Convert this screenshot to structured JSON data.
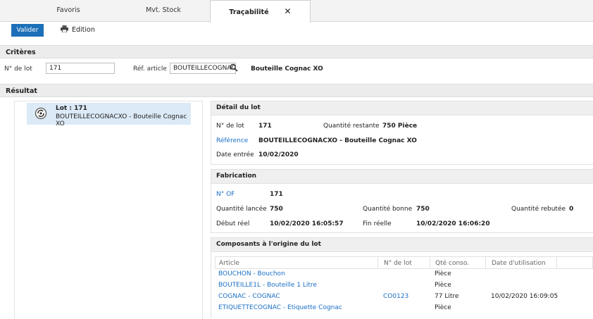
{
  "tabs": [
    {
      "label": "Favoris"
    },
    {
      "label": "Mvt. Stock"
    },
    {
      "label": "Traçabilité",
      "close": "✕"
    }
  ],
  "toolbar": {
    "valider": "Valider",
    "edition": "Edition"
  },
  "criteres": {
    "title": "Critères",
    "lot_label": "N° de lot",
    "lot_value": "171",
    "ref_label": "Réf. article",
    "ref_value": "BOUTEILLECOGNACXO",
    "ref_desc": "Bouteille Cognac XO"
  },
  "resultat": {
    "title": "Résultat",
    "lot_title": "Lot : 171",
    "lot_sub": "BOUTEILLECOGNACXO - Bouteille Cognac XO"
  },
  "detail": {
    "title": "Détail du lot",
    "lot_label": "N° de lot",
    "lot_value": "171",
    "qte_rest_label": "Quantité restante",
    "qte_rest_value": "750 Pièce",
    "ref_label": "Référence",
    "ref_value": "BOUTEILLECOGNACXO - Bouteille Cognac XO",
    "date_label": "Date entrée",
    "date_value": "10/02/2020"
  },
  "fabrication": {
    "title": "Fabrication",
    "of_label": "N° OF",
    "of_value": "171",
    "qte_lancee_label": "Quantité lancée",
    "qte_lancee_value": "750",
    "qte_bonne_label": "Quantité bonne",
    "qte_bonne_value": "750",
    "qte_rebutee_label": "Quantité rebutée",
    "qte_rebutee_value": "0",
    "debut_label": "Début réel",
    "debut_value": "10/02/2020 16:05:57",
    "fin_label": "Fin réelle",
    "fin_value": "10/02/2020 16:06:20"
  },
  "composants": {
    "title": "Composants à l'origine du lot",
    "headers": {
      "article": "Article",
      "lot": "N° de lot",
      "qte": "Qté conso.",
      "date": "Date d'utilisation"
    },
    "rows": [
      {
        "article": "BOUCHON - Bouchon",
        "lot": "",
        "qte": "Pièce",
        "date": ""
      },
      {
        "article": "BOUTEILLE1L - Bouteille 1 Litre",
        "lot": "",
        "qte": "Pièce",
        "date": ""
      },
      {
        "article": "COGNAC - COGNAC",
        "lot": "CO0123",
        "qte": "77 Litre",
        "date": "10/02/2020 16:09:05"
      },
      {
        "article": "ETIQUETTECOGNAC - Etiquette Cognac",
        "lot": "",
        "qte": "Pièce",
        "date": ""
      }
    ]
  },
  "colors": {
    "accent": "#1c6fb8",
    "link": "#1a6fc4",
    "selected": "#dce9f6"
  }
}
